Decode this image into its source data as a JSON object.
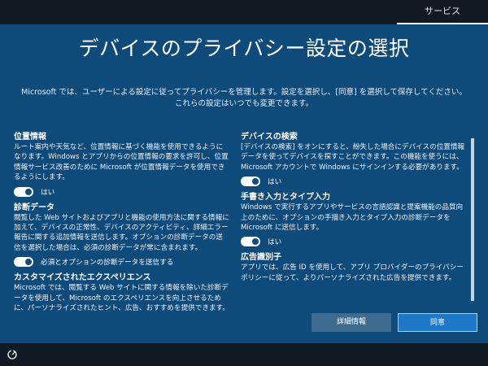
{
  "topbar": {
    "tab_label": "サービス"
  },
  "page": {
    "title": "デバイスのプライバシー設定の選択",
    "subtitle": "Microsoft では、ユーザーによる設定に従ってプライバシーを管理します。設定を選択し、[同意] を選択して保存してください。これらの設定はいつでも変更できます。"
  },
  "settings_left": [
    {
      "heading": "位置情報",
      "body": "ルート案内や天気など、位置情報に基づく機能を使用できるようになります。Windows とアプリからの位置情報の要求を許可し、位置情報サービス改善のために Microsoft が位置情報データを使用できるようにします。",
      "toggle_label": "はい",
      "on": true
    },
    {
      "heading": "診断データ",
      "body": "閲覧した Web サイトおよびアプリと機能の使用方法に関する情報に加えて、デバイスの正常性、デバイスのアクティビティ、詳細エラー報告に関する追加情報を送信します。オプションの診断データの送信を選択した場合は、必須の診断データが常に含まれます。",
      "toggle_label": "必須とオプションの診断データを送信する",
      "on": true
    },
    {
      "heading": "カスタマイズされたエクスペリエンス",
      "body": "Microsoft では、閲覧する Web サイトに関する情報を除いた診断データを使用して、Microsoft のエクスペリエンスを向上させるために、パーソナライズされたヒント、広告、おすすめを提供できます。"
    }
  ],
  "settings_right": [
    {
      "heading": "デバイスの検索",
      "body": "[デバイスの検索] をオンにすると、紛失した場合にデバイスの位置情報データを使ってデバイスを探すことができます。この機能を使うには、Microsoft アカウントで Windows にサインインする必要があります。",
      "toggle_label": "はい",
      "on": true
    },
    {
      "heading": "手書き入力とタイプ入力",
      "body": "Windows で実行するアプリやサービスの言語認識と提案機能の品質向上のために、オプションの手描き入力とタイプ入力の診断データを Microsoft に送信します。",
      "toggle_label": "はい",
      "on": true
    },
    {
      "heading": "広告識別子",
      "body": "アプリでは、広告 ID を使用して、アプリ プロバイダーのプライバシー ポリシーに従って、よりパーソナライズされた広告を提供できます。"
    }
  ],
  "buttons": {
    "details": "詳細情報",
    "agree": "同意"
  },
  "colors": {
    "panel": "#0f4b7a",
    "accent": "#1f78c8",
    "frame": "#0f1a24"
  },
  "icons": {
    "bottom_left": "accessibility-icon"
  }
}
